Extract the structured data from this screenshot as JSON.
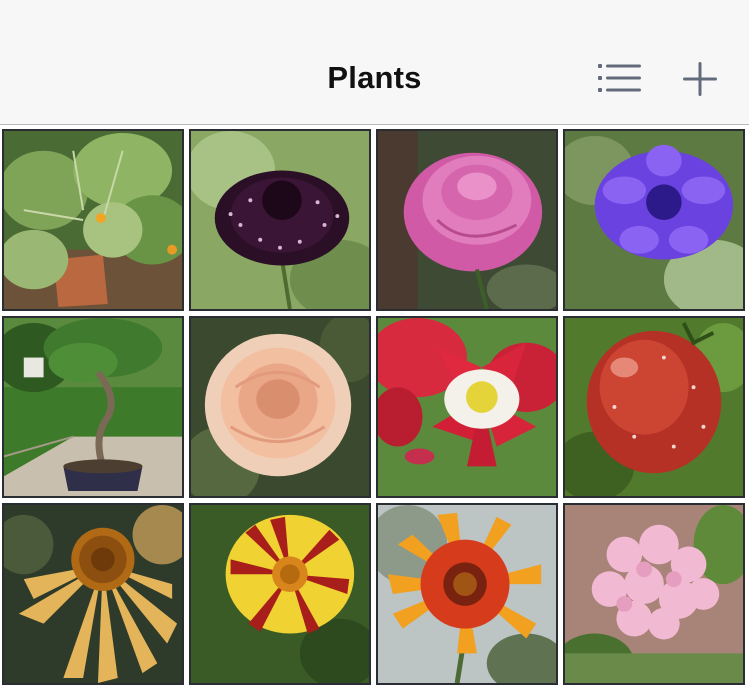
{
  "navbar": {
    "title": "Plants",
    "list_icon": "list-icon",
    "add_icon": "plus-icon",
    "icon_color": "#636b7a"
  },
  "plants": [
    {
      "name": "zucchini",
      "icon": "zucchini-plant-photo"
    },
    {
      "name": "dark-scabiosa",
      "icon": "dark-purple-flower-photo"
    },
    {
      "name": "pink-rose",
      "icon": "pink-rose-photo"
    },
    {
      "name": "cornflower",
      "icon": "blue-cornflower-photo"
    },
    {
      "name": "bonsai",
      "icon": "bonsai-tree-photo"
    },
    {
      "name": "peach-rose",
      "icon": "peach-rose-photo"
    },
    {
      "name": "columbine",
      "icon": "red-columbine-photo"
    },
    {
      "name": "tomato",
      "icon": "tomato-photo"
    },
    {
      "name": "coneflower",
      "icon": "coneflower-photo"
    },
    {
      "name": "marigold",
      "icon": "marigold-photo"
    },
    {
      "name": "gaillardia",
      "icon": "gaillardia-photo"
    },
    {
      "name": "candytuft",
      "icon": "pink-candytuft-photo"
    }
  ]
}
